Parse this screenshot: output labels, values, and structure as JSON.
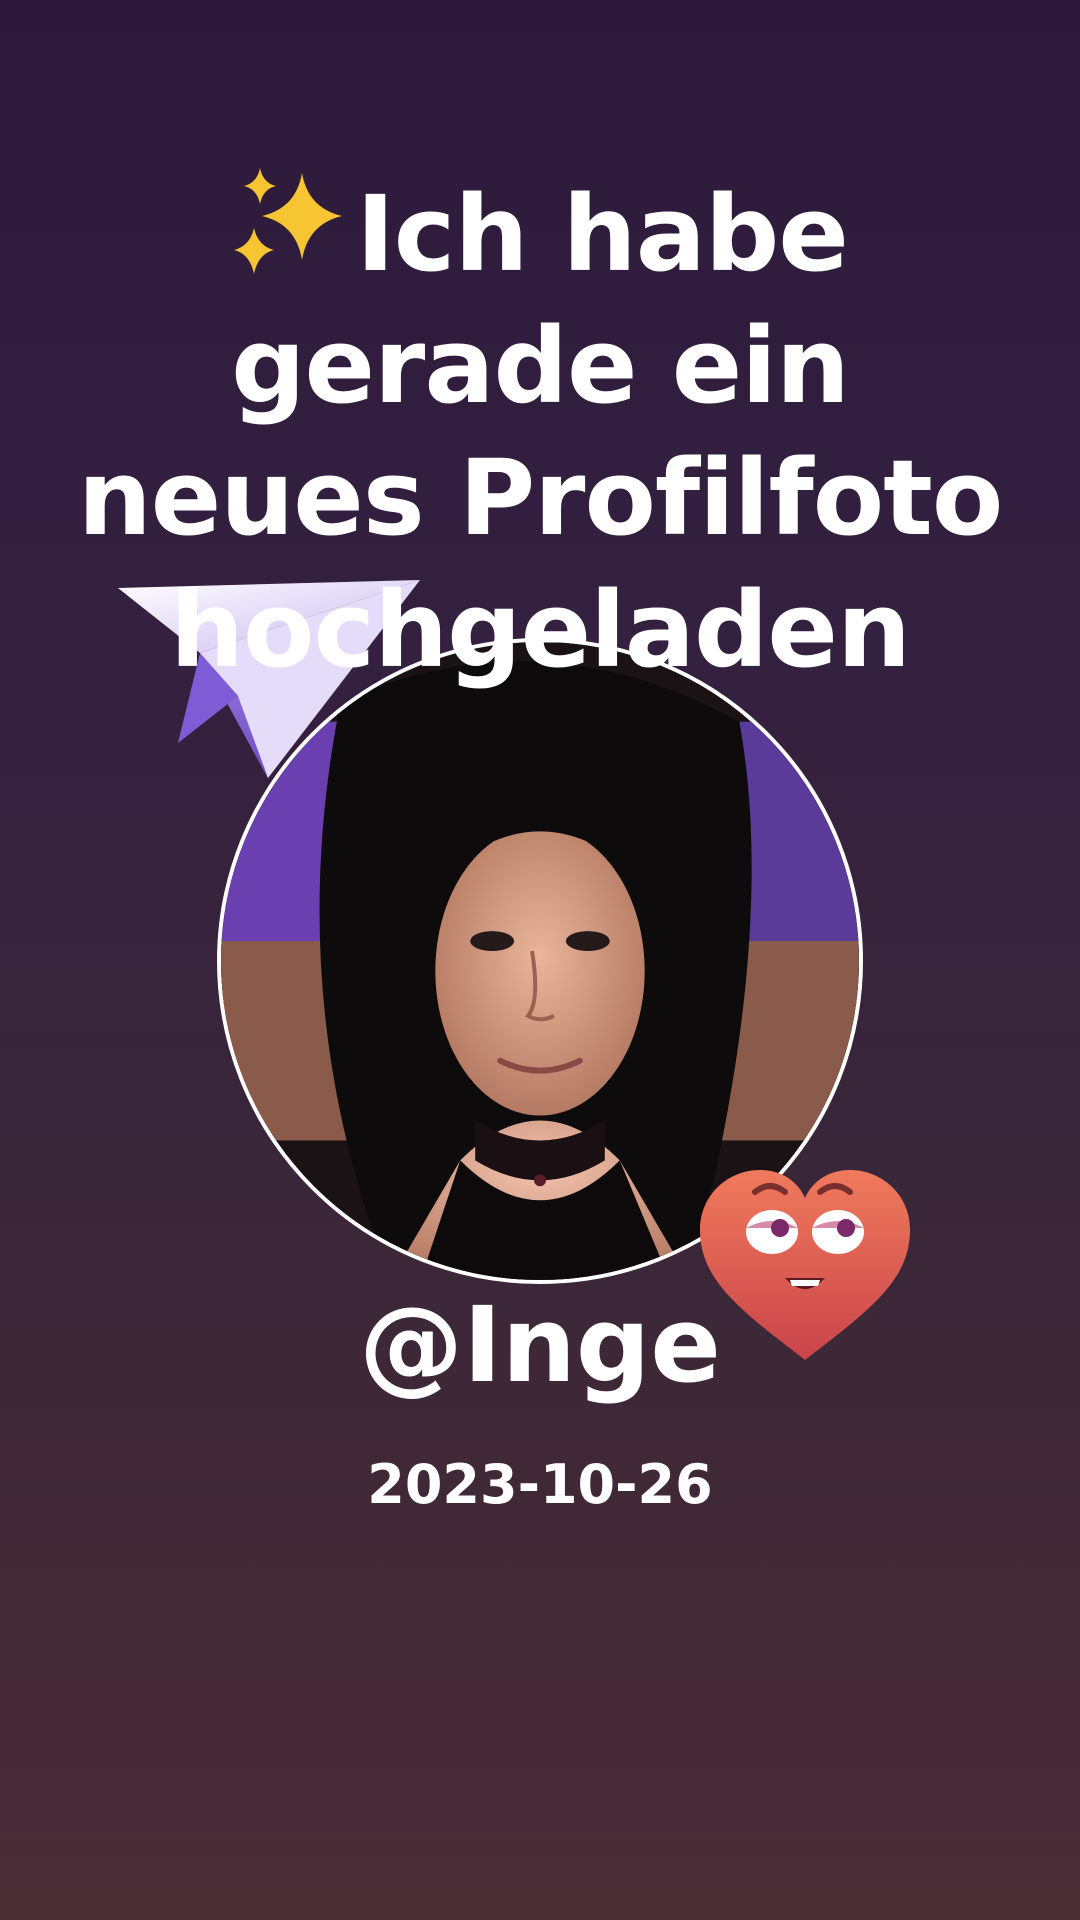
{
  "headline": {
    "emoji": "✨",
    "lines": [
      "Ich habe",
      "gerade ein",
      "neues Profilfoto",
      "hochgeladen"
    ]
  },
  "profile": {
    "username": "@Inge",
    "date": "2023-10-26"
  },
  "colors": {
    "background_top": "#2d1a3b",
    "background_bottom": "#4a2c35",
    "text": "#ffffff",
    "sparkle": "#f7c531",
    "heart": "#e0564c"
  },
  "icons": [
    "sparkles-icon",
    "paper-plane-icon",
    "heart-face-icon"
  ]
}
